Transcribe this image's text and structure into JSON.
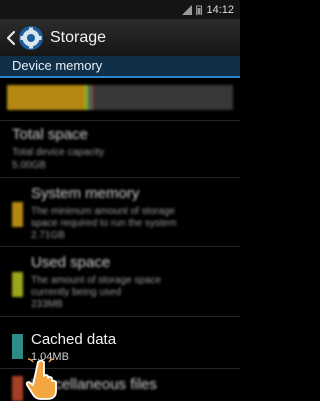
{
  "status_bar": {
    "time": "14:12"
  },
  "action_bar": {
    "title": "Storage"
  },
  "section_header": {
    "label": "Device memory"
  },
  "usage_bar": {
    "segments": [
      {
        "name": "system",
        "color": "#d4a017",
        "fraction": 0.34
      },
      {
        "name": "used",
        "color": "#b7c21f",
        "fraction": 0.02
      },
      {
        "name": "cached",
        "color": "#2e8c86",
        "fraction": 0.012
      },
      {
        "name": "misc",
        "color": "#c44a2e",
        "fraction": 0.01
      },
      {
        "name": "available",
        "color": "#424242",
        "fraction": 0.618
      }
    ]
  },
  "items": {
    "total": {
      "title": "Total space",
      "line1": "Total device capacity",
      "value": "5.00GB"
    },
    "system": {
      "title": "System memory",
      "line1": "The minimum amount of storage",
      "line2": "space required to run the system",
      "value": "2.71GB",
      "color": "#d4a017"
    },
    "used": {
      "title": "Used space",
      "line1": "The amount of storage space",
      "line2": "currently being used",
      "value": "233MB",
      "color": "#b7c21f"
    },
    "cached": {
      "title": "Cached data",
      "value": "1.04MB",
      "color": "#2e8c86"
    },
    "misc": {
      "title": "Miscellaneous files",
      "color": "#c44a2e"
    }
  }
}
